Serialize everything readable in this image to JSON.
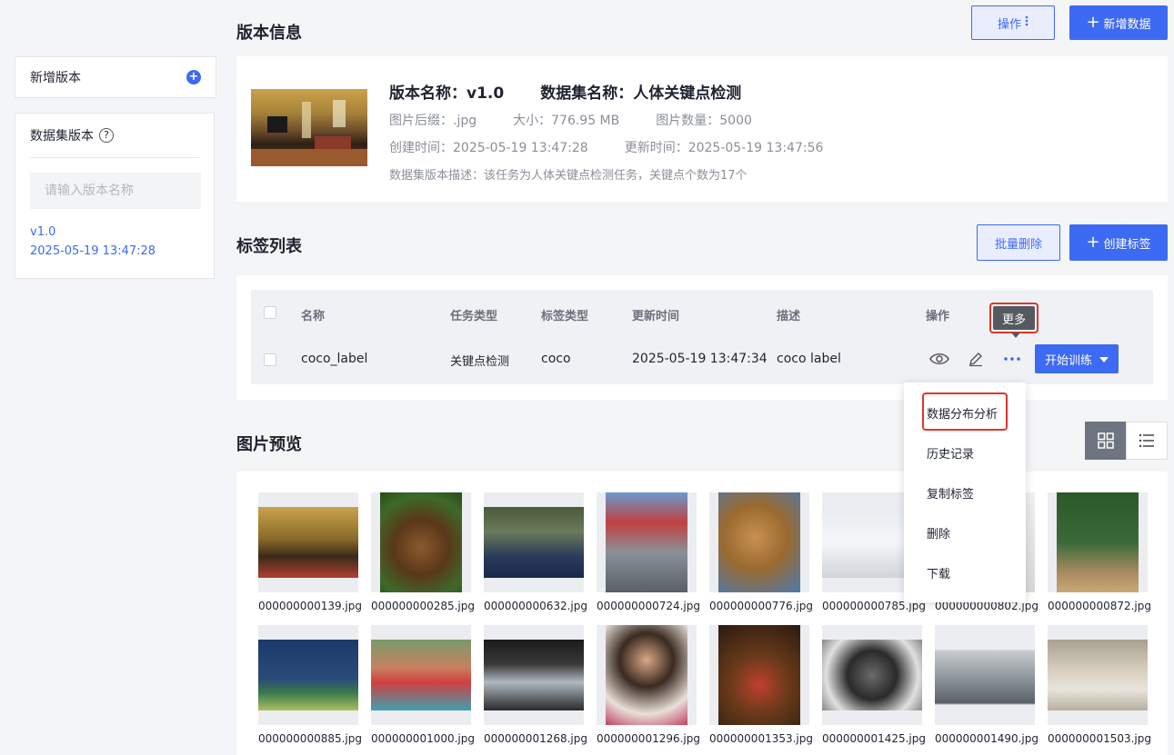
{
  "sidebar": {
    "add_version_label": "新增版本",
    "versions_title": "数据集版本",
    "help_glyph": "?",
    "search_placeholder": "请输入版本名称",
    "version_name": "v1.0",
    "version_time": "2025-05-19 13:47:28"
  },
  "version_info": {
    "title": "版本信息",
    "ops_label": "操作",
    "add_data_label": "新增数据",
    "name": "版本名称：v1.0",
    "dataset": "数据集名称：人体关键点检测",
    "suffix": "图片后缀：.jpg",
    "size": "大小：776.95 MB",
    "count": "图片数量：5000",
    "created": "创建时间：2025-05-19 13:47:28",
    "updated": "更新时间：2025-05-19 13:47:56",
    "description": "数据集版本描述：该任务为人体关键点检测任务，关键点个数为17个"
  },
  "label_list": {
    "title": "标签列表",
    "batch_delete_label": "批量删除",
    "create_label": "创建标签",
    "headers": {
      "name": "名称",
      "task_type": "任务类型",
      "label_type": "标签类型",
      "updated": "更新时间",
      "description": "描述",
      "actions": "操作"
    },
    "row": {
      "name": "coco_label",
      "task_type": "关键点检测",
      "label_type": "coco",
      "updated": "2025-05-19 13:47:34",
      "description": "coco label"
    },
    "tooltip": "更多",
    "train_label": "开始训练",
    "menu": [
      "数据分布分析",
      "历史记录",
      "复制标签",
      "删除",
      "下载"
    ]
  },
  "preview": {
    "title": "图片预览",
    "images": [
      {
        "name": "000000000139.jpg",
        "fill": "linear-gradient(180deg,#c9a24a 0%,#8a6a2a 45%,#3a2a1a 70%,#b04030 100%)"
      },
      {
        "name": "000000000285.jpg",
        "fill": "radial-gradient(circle at 50% 55%,#8a5a30 0%,#5a3818 40%,#3d6a2a 75%,#2a4a1a 100%)"
      },
      {
        "name": "000000000632.jpg",
        "fill": "linear-gradient(180deg,#4a5a3a 0%,#6a7a5a 35%,#2a3a5a 70%,#1a2a4a 100%)"
      },
      {
        "name": "000000000724.jpg",
        "fill": "linear-gradient(180deg,#6a9ad0 0%,#c04040 30%,#8a9098 60%,#5a6068 100%)"
      },
      {
        "name": "000000000776.jpg",
        "fill": "radial-gradient(circle at 45% 45%,#c89050 0%,#9a6a30 45%,#4a7ab0 100%)"
      },
      {
        "name": "000000000785.jpg",
        "fill": "linear-gradient(180deg,#e8ecf0 0%,#f4f6f8 50%,#d0d4d8 100%)"
      },
      {
        "name": "000000000802.jpg",
        "fill": "linear-gradient(180deg,#f0f0f0 0%,#d8d8d8 100%)"
      },
      {
        "name": "000000000872.jpg",
        "fill": "linear-gradient(180deg,#2a5a2a 0%,#3a6a3a 50%,#a88a60 80%,#c8a878 100%)"
      },
      {
        "name": "000000000885.jpg",
        "fill": "linear-gradient(180deg,#1a3a6a 0%,#2a4a7a 55%,#3a7a4a 75%,#a8c060 100%)"
      },
      {
        "name": "000000001000.jpg",
        "fill": "linear-gradient(180deg,#7a9a6a 0%,#c88060 40%,#d04040 60%,#40a0b0 100%)"
      },
      {
        "name": "000000001268.jpg",
        "fill": "linear-gradient(180deg,#1a1a1a 0%,#3a3a3a 35%,#b0b8c0 60%,#2a2a2a 100%)"
      },
      {
        "name": "000000001296.jpg",
        "fill": "radial-gradient(circle at 50% 35%,#d8a888 0%,#3a2a20 35%,#e8e0d8 70%,#c04060 100%)"
      },
      {
        "name": "000000001353.jpg",
        "fill": "radial-gradient(circle at 50% 60%,#c04030 0%,#6a3a1a 40%,#2a1a10 100%)"
      },
      {
        "name": "000000001425.jpg",
        "fill": "radial-gradient(circle at 50% 50%,#6a6a6a 0%,#2a2a2a 40%,#e0e0e0 75%,#888 100%)"
      },
      {
        "name": "000000001490.jpg",
        "fill": "linear-gradient(180deg,#ebedf1 0%,#ebedf1 24%,#c8ccd0 26%,#8a9098 55%,#5a6068 78%,#ebedf1 80%,#ebedf1 100%)"
      },
      {
        "name": "000000001503.jpg",
        "fill": "linear-gradient(180deg,#a8a090 0%,#d8d0c0 45%,#e8e4dc 70%,#b8b0a0 100%)"
      }
    ]
  },
  "colors": {
    "primary": "#3d6af2",
    "highlight_red": "#e0362a",
    "tooltip_bg": "#555a61"
  }
}
